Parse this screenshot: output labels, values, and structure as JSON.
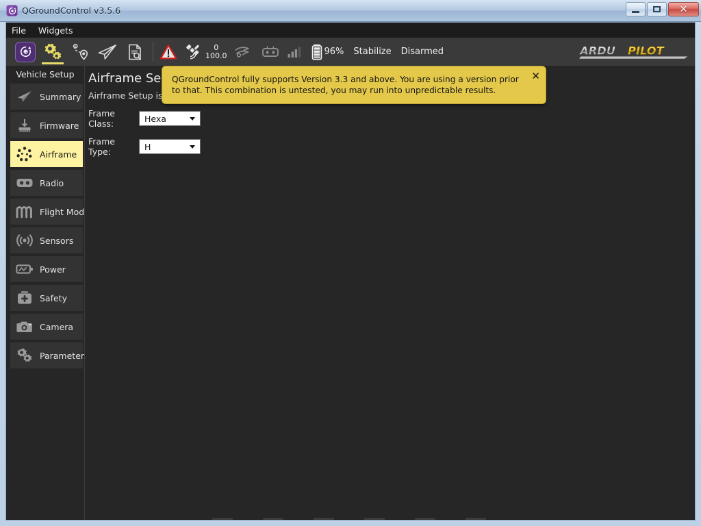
{
  "window": {
    "title": "QGroundControl v3.5.6",
    "app_icon": "qgroundcontrol-icon",
    "buttons": {
      "minimize": "minimize-button",
      "maximize": "maximize-button",
      "close": "close-button",
      "close_glyph": "✕"
    }
  },
  "menubar": {
    "items": [
      {
        "label": "File"
      },
      {
        "label": "Widgets"
      }
    ]
  },
  "toolbar": {
    "logo": "qgc-logo-icon",
    "nav": [
      {
        "name": "vehicle-setup",
        "icon": "gears-icon",
        "active": true
      },
      {
        "name": "plan",
        "icon": "waypoints-icon",
        "active": false
      },
      {
        "name": "fly",
        "icon": "paper-plane-icon",
        "active": false
      },
      {
        "name": "analyze",
        "icon": "document-search-icon",
        "active": false
      }
    ],
    "status": {
      "warning_icon": "warning-triangle-icon",
      "gps_icon": "satellite-icon",
      "gps_count": "0",
      "gps_hdop": "100.0",
      "telemetry_icon": "telemetry-icon",
      "rc_icon": "rc-controller-icon",
      "signal_icon": "signal-bars-icon",
      "battery_icon": "battery-icon",
      "battery_percent": "96%",
      "flight_mode": "Stabilize",
      "arm_state": "Disarmed"
    },
    "brand": {
      "part1": "ARDU",
      "part2": "PILOT",
      "color1": "#e8e8e8",
      "color2": "#f3c419"
    }
  },
  "sidebar": {
    "title": "Vehicle Setup",
    "items": [
      {
        "label": "Summary",
        "icon": "paper-plane-icon",
        "selected": false
      },
      {
        "label": "Firmware",
        "icon": "download-chip-icon",
        "selected": false
      },
      {
        "label": "Airframe",
        "icon": "airframe-dots-icon",
        "selected": true
      },
      {
        "label": "Radio",
        "icon": "rc-controller-icon",
        "selected": false
      },
      {
        "label": "Flight Modes",
        "icon": "waveform-icon",
        "selected": false
      },
      {
        "label": "Sensors",
        "icon": "sensor-waves-icon",
        "selected": false
      },
      {
        "label": "Power",
        "icon": "battery-icon",
        "selected": false
      },
      {
        "label": "Safety",
        "icon": "first-aid-icon",
        "selected": false
      },
      {
        "label": "Camera",
        "icon": "camera-icon",
        "selected": false
      },
      {
        "label": "Parameters",
        "icon": "gears-icon",
        "selected": false
      }
    ],
    "selected_bg": "#fdf3a0"
  },
  "content": {
    "title": "Airframe Setup",
    "subtitle": "Airframe Setup is used",
    "fields": [
      {
        "label": "Frame Class:",
        "value": "Hexa"
      },
      {
        "label": "Frame Type:",
        "value": "H"
      }
    ]
  },
  "banner": {
    "text": "QGroundControl fully supports Version 3.3 and above. You are using a version prior to that. This combination is untested, you may run into unpredictable results.",
    "close_glyph": "✕",
    "bg_color": "#e3c84a"
  }
}
